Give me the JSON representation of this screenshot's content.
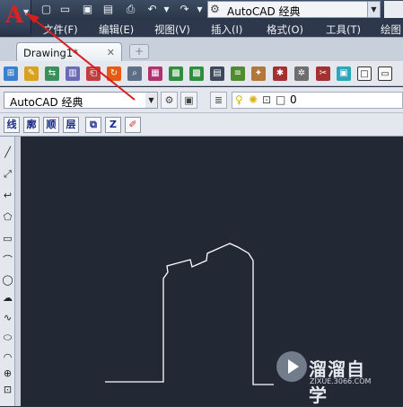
{
  "app": {
    "logo_letter": "A"
  },
  "quick_access": {
    "workspace": "AutoCAD 经典"
  },
  "menus": [
    "文件(F)",
    "编辑(E)",
    "视图(V)",
    "插入(I)",
    "格式(O)",
    "工具(T)",
    "绘图"
  ],
  "tabs": {
    "active": "Drawing1*",
    "close": "✕",
    "new": "+"
  },
  "toolbar2": {
    "workspace": "AutoCAD 经典",
    "layer_name": "0"
  },
  "toolbar3": {
    "buttons": [
      "线",
      "廓",
      "顺",
      "层"
    ]
  },
  "colors": {
    "annotation_arrow": "#d81e1e",
    "canvas": "#222935",
    "drawing_line": "#ffffff"
  },
  "watermark": {
    "name": "溜溜自学",
    "url": "ZIXUE.3066.COM"
  }
}
